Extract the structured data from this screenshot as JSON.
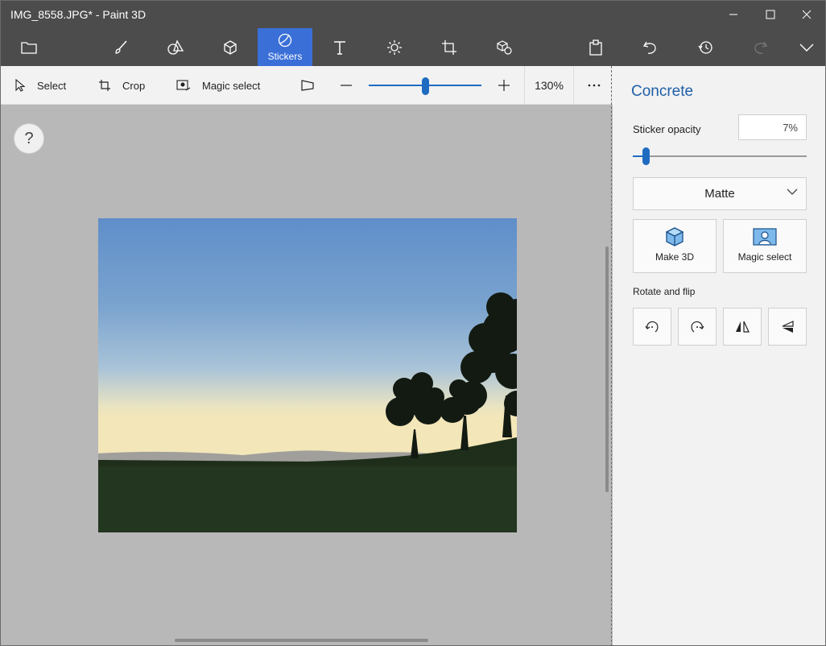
{
  "window": {
    "title": "IMG_8558.JPG* - Paint 3D"
  },
  "ribbon": {
    "active_tab_label": "Stickers"
  },
  "toolbar": {
    "select_label": "Select",
    "crop_label": "Crop",
    "magic_select_label": "Magic select",
    "zoom_value": "130%"
  },
  "canvas": {
    "help_label": "?"
  },
  "panel": {
    "title": "Concrete",
    "opacity_label": "Sticker opacity",
    "opacity_value": "7%",
    "finish_selected": "Matte",
    "make3d_label": "Make 3D",
    "magic_select_label": "Magic select",
    "rotate_flip_label": "Rotate and flip"
  },
  "colors": {
    "accent": "#3a6fd8",
    "panel_title": "#1f5fa8",
    "ribbon_bg": "#4c4c4c"
  }
}
